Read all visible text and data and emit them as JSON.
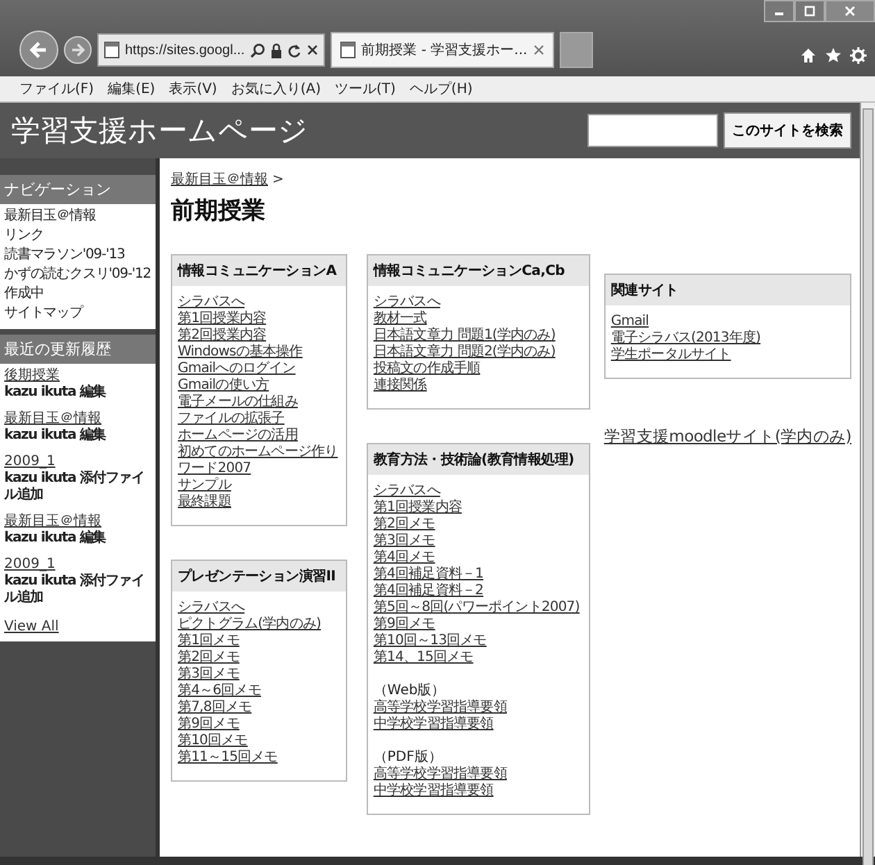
{
  "browser": {
    "address": "https://sites.googl...",
    "tab_title": "前期授業 - 学習支援ホー...",
    "menu": [
      "ファイル(F)",
      "編集(E)",
      "表示(V)",
      "お気に入り(A)",
      "ツール(T)",
      "ヘルプ(H)"
    ]
  },
  "site": {
    "title": "学習支援ホームページ",
    "search_button": "このサイトを検索"
  },
  "sidebar": {
    "nav_heading": "ナビゲーション",
    "nav_items": [
      "最新目玉＠情報",
      "リンク",
      "読書マラソン'09-'13",
      "かずの読むクスリ'09-'12",
      "作成中",
      "サイトマップ"
    ],
    "recent_heading": "最近の更新履歴",
    "recent": [
      {
        "link": "後期授業",
        "meta": "kazu ikuta 編集"
      },
      {
        "link": "最新目玉＠情報",
        "meta": "kazu ikuta 編集"
      },
      {
        "link": "2009_1",
        "meta": "kazu ikuta 添付ファイル追加"
      },
      {
        "link": "最新目玉＠情報",
        "meta": "kazu ikuta 編集"
      },
      {
        "link": "2009_1",
        "meta": "kazu ikuta 添付ファイル追加"
      }
    ],
    "view_all": "View All"
  },
  "page": {
    "breadcrumb": "最新目玉＠情報",
    "breadcrumb_sep": ">",
    "title": "前期授業"
  },
  "columns": [
    [
      {
        "kind": "box",
        "heading": "情報コミュニケーションA",
        "items": [
          {
            "kind": "link",
            "text": "シラバスへ"
          },
          {
            "kind": "link",
            "text": "第1回授業内容"
          },
          {
            "kind": "link",
            "text": "第2回授業内容"
          },
          {
            "kind": "link",
            "text": "Windowsの基本操作"
          },
          {
            "kind": "link",
            "text": "Gmailへのログイン"
          },
          {
            "kind": "link",
            "text": "Gmailの使い方"
          },
          {
            "kind": "link",
            "text": "電子メールの仕組み"
          },
          {
            "kind": "link",
            "text": "ファイルの拡張子"
          },
          {
            "kind": "link",
            "text": "ホームページの活用"
          },
          {
            "kind": "link",
            "text": "初めてのホームページ作り"
          },
          {
            "kind": "link",
            "text": "ワード2007"
          },
          {
            "kind": "link",
            "text": "サンプル"
          },
          {
            "kind": "link",
            "text": "最終課題"
          }
        ]
      },
      {
        "kind": "box",
        "heading": "プレゼンテーション演習II",
        "items": [
          {
            "kind": "link",
            "text": "シラバスへ"
          },
          {
            "kind": "link",
            "text": "ピクトグラム(学内のみ)"
          },
          {
            "kind": "link",
            "text": "第1回メモ"
          },
          {
            "kind": "link",
            "text": "第2回メモ"
          },
          {
            "kind": "link",
            "text": "第3回メモ"
          },
          {
            "kind": "link",
            "text": "第4～6回メモ"
          },
          {
            "kind": "link",
            "text": "第7,8回メモ"
          },
          {
            "kind": "link",
            "text": "第9回メモ"
          },
          {
            "kind": "link",
            "text": "第10回メモ"
          },
          {
            "kind": "link",
            "text": "第11～15回メモ"
          }
        ]
      }
    ],
    [
      {
        "kind": "box",
        "heading": "情報コミュニケーションCa,Cb",
        "items": [
          {
            "kind": "link",
            "text": "シラバスへ"
          },
          {
            "kind": "link",
            "text": "教材一式"
          },
          {
            "kind": "link",
            "text": "日本語文章力 問題1(学内のみ)"
          },
          {
            "kind": "link",
            "text": "日本語文章力 問題2(学内のみ)"
          },
          {
            "kind": "link",
            "text": "投稿文の作成手順"
          },
          {
            "kind": "link",
            "text": "連接関係"
          }
        ]
      },
      {
        "kind": "box",
        "heading": "教育方法・技術論(教育情報処理)",
        "items": [
          {
            "kind": "link",
            "text": "シラバスへ"
          },
          {
            "kind": "link",
            "text": "第1回授業内容"
          },
          {
            "kind": "link",
            "text": "第2回メモ"
          },
          {
            "kind": "link",
            "text": "第3回メモ"
          },
          {
            "kind": "link",
            "text": "第4回メモ"
          },
          {
            "kind": "link",
            "text": "第4回補足資料－1"
          },
          {
            "kind": "link",
            "text": "第4回補足資料－2"
          },
          {
            "kind": "link",
            "text": "第5回～8回(パワーポイント2007)"
          },
          {
            "kind": "link",
            "text": "第9回メモ"
          },
          {
            "kind": "link",
            "text": "第10回～13回メモ"
          },
          {
            "kind": "link",
            "text": "第14、15回メモ"
          },
          {
            "kind": "label",
            "text": "（Web版）"
          },
          {
            "kind": "link",
            "text": "高等学校学習指導要領"
          },
          {
            "kind": "link",
            "text": "中学校学習指導要領"
          },
          {
            "kind": "label",
            "text": "（PDF版）"
          },
          {
            "kind": "link",
            "text": "高等学校学習指導要領"
          },
          {
            "kind": "link",
            "text": "中学校学習指導要領"
          }
        ]
      }
    ],
    [
      {
        "kind": "box",
        "heading": "関連サイト",
        "items": [
          {
            "kind": "link",
            "text": "Gmail"
          },
          {
            "kind": "link",
            "text": "電子シラバス(2013年度)"
          },
          {
            "kind": "link",
            "text": "学生ポータルサイト"
          }
        ]
      },
      {
        "kind": "big_link",
        "text": "学習支援moodleサイト(学内のみ)"
      }
    ]
  ]
}
